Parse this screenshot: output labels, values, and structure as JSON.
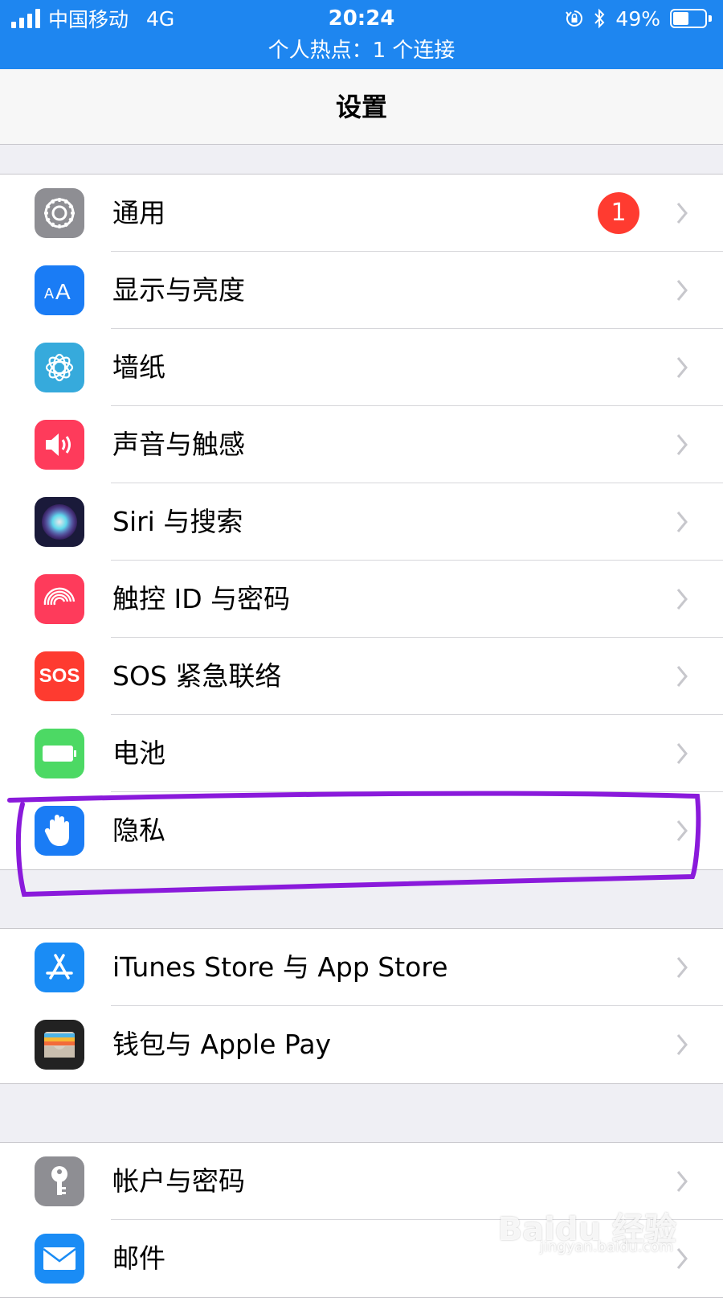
{
  "status_bar": {
    "carrier": "中国移动",
    "network": "4G",
    "time": "20:24",
    "battery_percent": "49%",
    "battery_level": 0.49,
    "hotspot_text": "个人热点：1 个连接",
    "color": "#1e86f0"
  },
  "nav": {
    "title": "设置"
  },
  "groups": [
    {
      "items": [
        {
          "label": "通用",
          "icon": "gear-icon",
          "color": "#8e8e93",
          "badge": "1"
        },
        {
          "label": "显示与亮度",
          "icon": "text-size-icon",
          "color": "#1a7cf5"
        },
        {
          "label": "墙纸",
          "icon": "flower-icon",
          "color": "#36aadc"
        },
        {
          "label": "声音与触感",
          "icon": "speaker-icon",
          "color": "#fe3b5b"
        },
        {
          "label": "Siri 与搜索",
          "icon": "siri-icon",
          "color": "#1a1a3a"
        },
        {
          "label": "触控 ID 与密码",
          "icon": "fingerprint-icon",
          "color": "#fe3b5b"
        },
        {
          "label": "SOS 紧急联络",
          "icon": "sos-icon",
          "color": "#fe3b30",
          "icon_text": "SOS"
        },
        {
          "label": "电池",
          "icon": "battery-icon",
          "color": "#4cd964"
        },
        {
          "label": "隐私",
          "icon": "hand-icon",
          "color": "#1a7cf5",
          "highlighted": true
        }
      ]
    },
    {
      "items": [
        {
          "label": "iTunes Store 与 App Store",
          "icon": "app-store-icon",
          "color": "#1a8cf5"
        },
        {
          "label": "钱包与 Apple Pay",
          "icon": "wallet-icon",
          "color": "#222222"
        }
      ]
    },
    {
      "items": [
        {
          "label": "帐户与密码",
          "icon": "key-icon",
          "color": "#8e8e93"
        },
        {
          "label": "邮件",
          "icon": "mail-icon",
          "color": "#1a8cf5"
        }
      ]
    }
  ],
  "annotation_color": "#8a1adb",
  "watermark": {
    "brand": "Baidu 经验",
    "url": "jingyan.baidu.com"
  }
}
